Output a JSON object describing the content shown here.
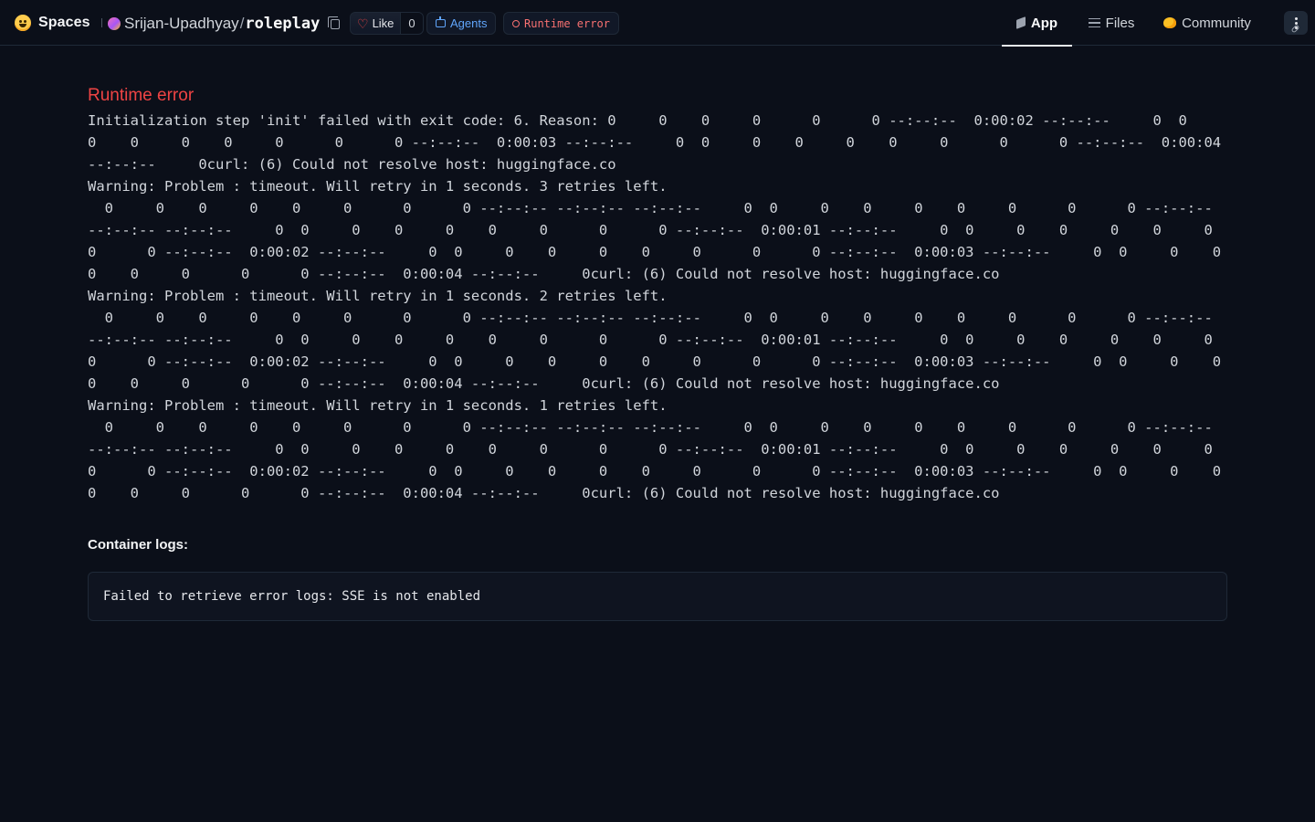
{
  "header": {
    "brand_label": "Spaces",
    "repo_owner": "Srijan-Upadhyay",
    "repo_separator": "/",
    "repo_name": "roleplay",
    "like_label": "Like",
    "like_count": "0",
    "agents_label": "Agents",
    "status_label": "Runtime error",
    "colors": {
      "background": "#0b0f19",
      "error": "#ef4444",
      "agents": "#60a5fa",
      "heart": "#ef4444"
    }
  },
  "nav": {
    "tabs": [
      {
        "label": "App",
        "icon": "cube-icon",
        "active": true
      },
      {
        "label": "Files",
        "icon": "files-icon",
        "active": false
      },
      {
        "label": "Community",
        "icon": "community-icon",
        "active": false
      }
    ],
    "more_icon": "more-vertical-icon"
  },
  "main": {
    "error_title": "Runtime error",
    "error_message": "Initialization step 'init' failed with exit code: 6. Reason: 0     0    0     0      0      0 --:--:--  0:00:02 --:--:--     0  0     0    0     0    0     0      0      0 --:--:--  0:00:03 --:--:--     0  0     0    0     0    0     0      0      0 --:--:--  0:00:04 --:--:--     0curl: (6) Could not resolve host: huggingface.co\nWarning: Problem : timeout. Will retry in 1 seconds. 3 retries left.\n  0     0    0     0    0     0      0      0 --:--:-- --:--:-- --:--:--     0  0     0    0     0    0     0      0      0 --:--:-- --:--:-- --:--:--     0  0     0    0     0    0     0      0      0 --:--:--  0:00:01 --:--:--     0  0     0    0     0    0     0      0      0 --:--:--  0:00:02 --:--:--     0  0     0    0     0    0     0      0      0 --:--:--  0:00:03 --:--:--     0  0     0    0     0    0     0      0      0 --:--:--  0:00:04 --:--:--     0curl: (6) Could not resolve host: huggingface.co\nWarning: Problem : timeout. Will retry in 1 seconds. 2 retries left.\n  0     0    0     0    0     0      0      0 --:--:-- --:--:-- --:--:--     0  0     0    0     0    0     0      0      0 --:--:-- --:--:-- --:--:--     0  0     0    0     0    0     0      0      0 --:--:--  0:00:01 --:--:--     0  0     0    0     0    0     0      0      0 --:--:--  0:00:02 --:--:--     0  0     0    0     0    0     0      0      0 --:--:--  0:00:03 --:--:--     0  0     0    0     0    0     0      0      0 --:--:--  0:00:04 --:--:--     0curl: (6) Could not resolve host: huggingface.co\nWarning: Problem : timeout. Will retry in 1 seconds. 1 retries left.\n  0     0    0     0    0     0      0      0 --:--:-- --:--:-- --:--:--     0  0     0    0     0    0     0      0      0 --:--:-- --:--:-- --:--:--     0  0     0    0     0    0     0      0      0 --:--:--  0:00:01 --:--:--     0  0     0    0     0    0     0      0      0 --:--:--  0:00:02 --:--:--     0  0     0    0     0    0     0      0      0 --:--:--  0:00:03 --:--:--     0  0     0    0     0    0     0      0      0 --:--:--  0:00:04 --:--:--     0curl: (6) Could not resolve host: huggingface.co",
    "logs_heading": "Container logs:",
    "logs_text": "Failed to retrieve error logs: SSE is not enabled"
  }
}
